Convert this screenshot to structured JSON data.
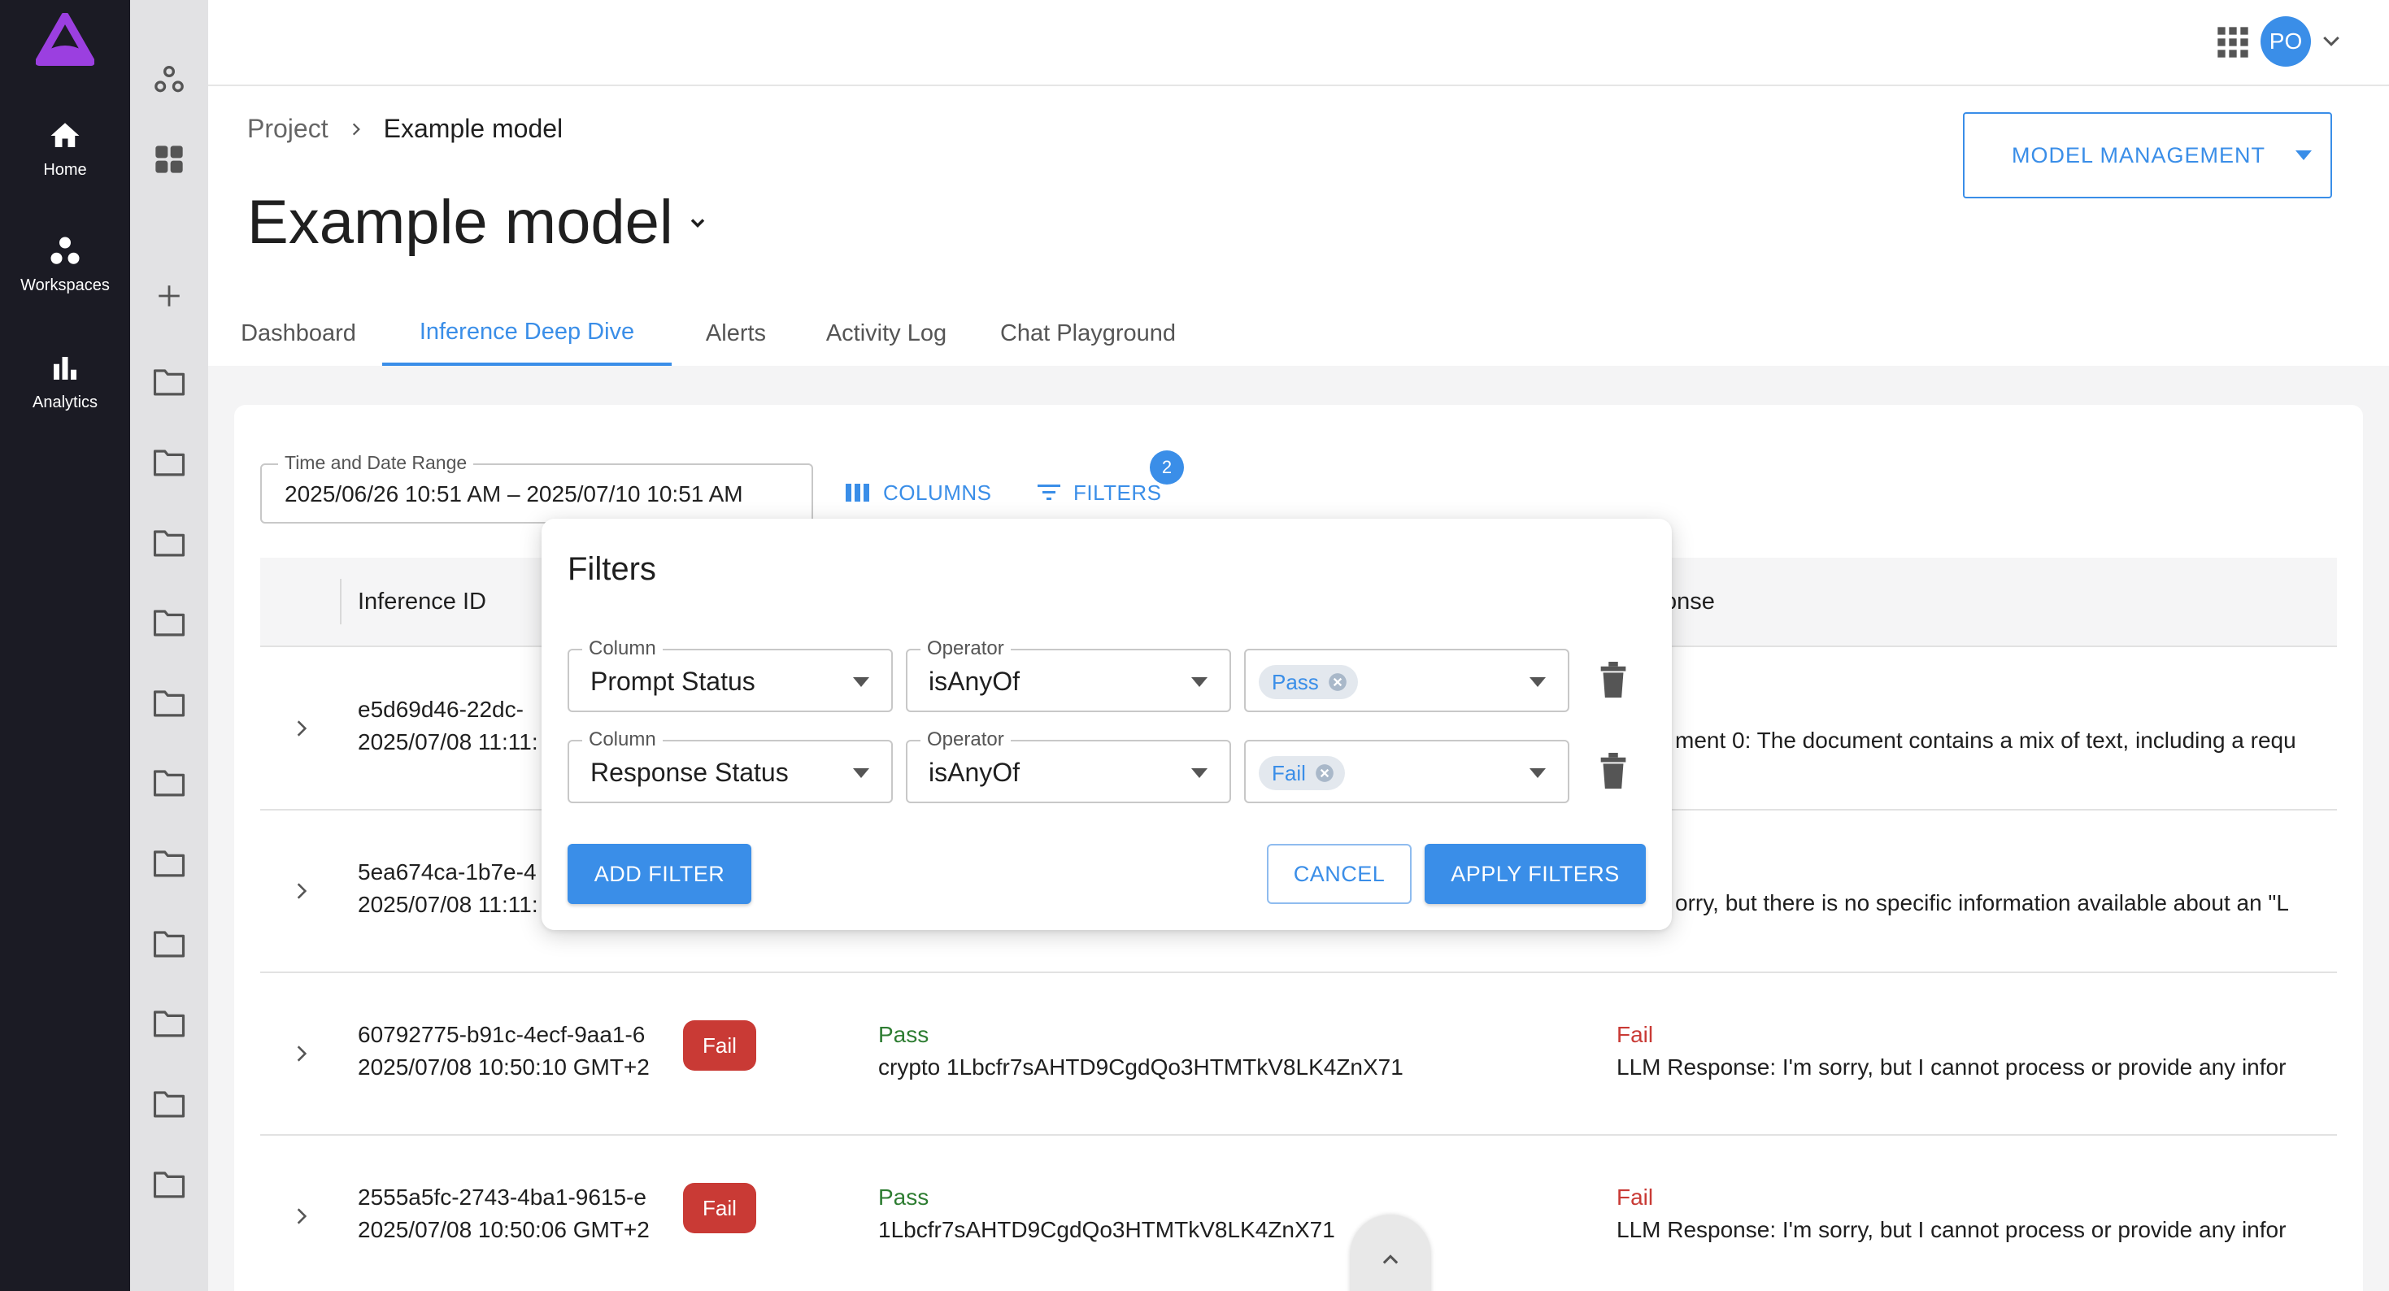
{
  "nav": {
    "items": [
      {
        "label": "Home",
        "icon": "home-icon"
      },
      {
        "label": "Workspaces",
        "icon": "workspaces-icon"
      },
      {
        "label": "Analytics",
        "icon": "analytics-icon"
      }
    ]
  },
  "topbar": {
    "avatar_initials": "PO"
  },
  "breadcrumb": {
    "project": "Project",
    "current": "Example model"
  },
  "page": {
    "title": "Example model",
    "model_management_label": "MODEL MANAGEMENT"
  },
  "tabs": [
    {
      "label": "Dashboard",
      "active": false
    },
    {
      "label": "Inference Deep Dive",
      "active": true
    },
    {
      "label": "Alerts",
      "active": false
    },
    {
      "label": "Activity Log",
      "active": false
    },
    {
      "label": "Chat Playground",
      "active": false
    }
  ],
  "toolbar": {
    "date_label": "Time and Date Range",
    "date_value": "2025/06/26 10:51 AM – 2025/07/10 10:51 AM",
    "columns_label": "COLUMNS",
    "filters_label": "FILTERS",
    "filters_count": "2"
  },
  "table": {
    "headers": {
      "inference_id": "Inference ID",
      "response_partial": "onse"
    },
    "rows": [
      {
        "id": "e5d69d46-22dc-",
        "date": "2025/07/08 11:11:",
        "response_text": "ment 0: The document contains a mix of text, including a requ"
      },
      {
        "id": "5ea674ca-1b7e-4",
        "date": "2025/07/08 11:11:",
        "response_text": "orry, but there is no specific information available about an \"L"
      },
      {
        "id": "60792775-b91c-4ecf-9aa1-6",
        "date": "2025/07/08 10:50:10 GMT+2",
        "chip": "Fail",
        "prompt_status": "Pass",
        "prompt_text": "crypto 1Lbcfr7sAHTD9CgdQo3HTMTkV8LK4ZnX71",
        "response_status": "Fail",
        "response_text": "LLM Response: I'm sorry, but I cannot process or provide any infor"
      },
      {
        "id": "2555a5fc-2743-4ba1-9615-e",
        "date": "2025/07/08 10:50:06 GMT+2",
        "chip": "Fail",
        "prompt_status": "Pass",
        "prompt_text": "1Lbcfr7sAHTD9CgdQo3HTMTkV8LK4ZnX71",
        "response_status": "Fail",
        "response_text": "LLM Response: I'm sorry, but I cannot process or provide any infor"
      }
    ]
  },
  "filters_popup": {
    "title": "Filters",
    "column_label": "Column",
    "operator_label": "Operator",
    "rows": [
      {
        "column": "Prompt Status",
        "operator": "isAnyOf",
        "value": "Pass"
      },
      {
        "column": "Response Status",
        "operator": "isAnyOf",
        "value": "Fail"
      }
    ],
    "add_filter": "ADD FILTER",
    "cancel": "CANCEL",
    "apply": "APPLY FILTERS"
  },
  "colors": {
    "accent": "#3a8ee8",
    "nav_bg": "#1b1b24",
    "fail": "#c93a35",
    "pass": "#2e7d32",
    "logo": "#9b3fe0"
  }
}
